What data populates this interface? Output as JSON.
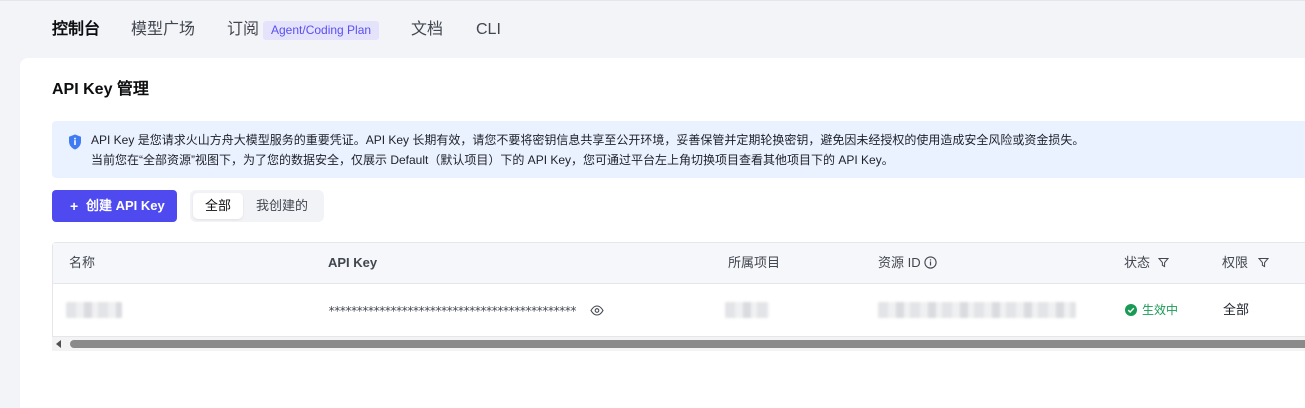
{
  "nav": {
    "items": [
      {
        "label": "控制台"
      },
      {
        "label": "模型广场"
      },
      {
        "label": "订阅"
      },
      {
        "label": "文档"
      },
      {
        "label": "CLI"
      }
    ],
    "badge": "Agent/Coding Plan"
  },
  "page": {
    "title": "API Key 管理"
  },
  "notice": {
    "line1": "API Key 是您请求火山方舟大模型服务的重要凭证。API Key 长期有效，请您不要将密钥信息共享至公开环境，妥善保管并定期轮换密钥，避免因未经授权的使用造成安全风险或资金损失。",
    "line2": "当前您在“全部资源”视图下，为了您的数据安全，仅展示 Default（默认项目）下的 API Key，您可通过平台左上角切换项目查看其他项目下的 API Key。",
    "icon": "shield-icon"
  },
  "toolbar": {
    "create_label": "创建 API Key",
    "filter_all": "全部",
    "filter_mine": "我创建的"
  },
  "table": {
    "columns": [
      "名称",
      "API Key",
      "所属项目",
      "资源 ID",
      "状态",
      "权限"
    ],
    "rows": [
      {
        "api_key_masked": "********************************************",
        "status": "生效中",
        "permission": "全部"
      }
    ]
  },
  "colors": {
    "accent": "#4f4af0",
    "status_active": "#1a9a55",
    "notice_bg": "#eaf1ff"
  }
}
